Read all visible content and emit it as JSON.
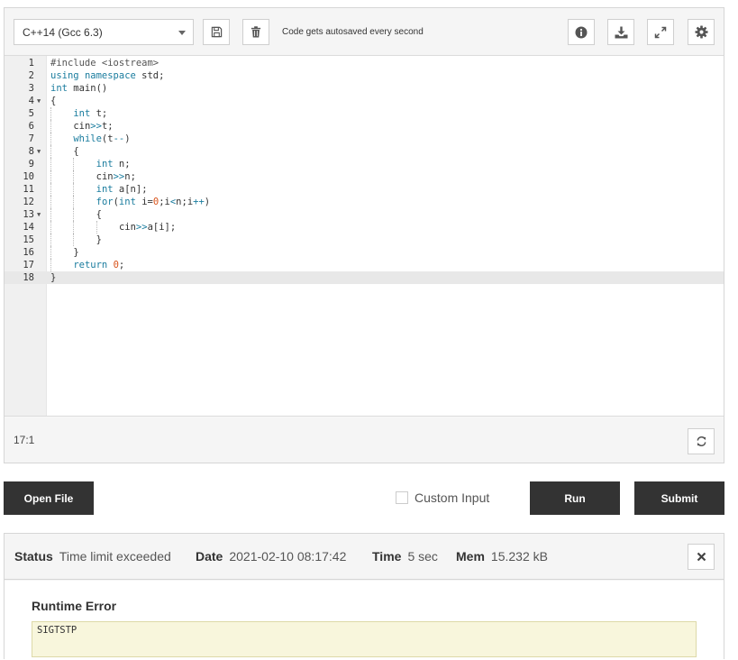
{
  "toolbar": {
    "language": "C++14 (Gcc 6.3)",
    "autosave_text": "Code gets autosaved every second",
    "icons": [
      "save-icon",
      "trash-icon",
      "info-icon",
      "download-icon",
      "expand-icon",
      "gear-icon"
    ]
  },
  "editor": {
    "active_line": 18,
    "lines": [
      {
        "n": "1",
        "fold": false,
        "indent": 0,
        "tokens": [
          [
            "pp",
            "#include <iostream>"
          ]
        ]
      },
      {
        "n": "2",
        "fold": false,
        "indent": 0,
        "tokens": [
          [
            "kw",
            "using"
          ],
          [
            "",
            " "
          ],
          [
            "kw",
            "namespace"
          ],
          [
            "",
            " std;"
          ]
        ]
      },
      {
        "n": "3",
        "fold": false,
        "indent": 0,
        "tokens": [
          [
            "kw",
            "int"
          ],
          [
            "",
            " main()"
          ]
        ]
      },
      {
        "n": "4",
        "fold": true,
        "indent": 0,
        "tokens": [
          [
            "",
            "{"
          ]
        ]
      },
      {
        "n": "5",
        "fold": false,
        "indent": 1,
        "tokens": [
          [
            "kw",
            "int"
          ],
          [
            "",
            " t;"
          ]
        ]
      },
      {
        "n": "6",
        "fold": false,
        "indent": 1,
        "tokens": [
          [
            "",
            "cin"
          ],
          [
            "kw",
            ">>"
          ],
          [
            "",
            "t;"
          ]
        ]
      },
      {
        "n": "7",
        "fold": false,
        "indent": 1,
        "tokens": [
          [
            "kw",
            "while"
          ],
          [
            "",
            "(t"
          ],
          [
            "kw",
            "--"
          ],
          [
            "",
            ")"
          ]
        ]
      },
      {
        "n": "8",
        "fold": true,
        "indent": 1,
        "tokens": [
          [
            "",
            "{"
          ]
        ]
      },
      {
        "n": "9",
        "fold": false,
        "indent": 2,
        "tokens": [
          [
            "kw",
            "int"
          ],
          [
            "",
            " n;"
          ]
        ]
      },
      {
        "n": "10",
        "fold": false,
        "indent": 2,
        "tokens": [
          [
            "",
            "cin"
          ],
          [
            "kw",
            ">>"
          ],
          [
            "",
            "n;"
          ]
        ]
      },
      {
        "n": "11",
        "fold": false,
        "indent": 2,
        "tokens": [
          [
            "kw",
            "int"
          ],
          [
            "",
            " a[n];"
          ]
        ]
      },
      {
        "n": "12",
        "fold": false,
        "indent": 2,
        "tokens": [
          [
            "kw",
            "for"
          ],
          [
            "",
            "("
          ],
          [
            "kw",
            "int"
          ],
          [
            "",
            " i="
          ],
          [
            "num",
            "0"
          ],
          [
            "",
            ";i"
          ],
          [
            "kw",
            "<"
          ],
          [
            "",
            "n;i"
          ],
          [
            "kw",
            "++"
          ],
          [
            "",
            ")"
          ]
        ]
      },
      {
        "n": "13",
        "fold": true,
        "indent": 2,
        "tokens": [
          [
            "",
            "{"
          ]
        ]
      },
      {
        "n": "14",
        "fold": false,
        "indent": 3,
        "tokens": [
          [
            "",
            "cin"
          ],
          [
            "kw",
            ">>"
          ],
          [
            "",
            "a[i];"
          ]
        ]
      },
      {
        "n": "15",
        "fold": false,
        "indent": 2,
        "tokens": [
          [
            "",
            "}"
          ]
        ]
      },
      {
        "n": "16",
        "fold": false,
        "indent": 1,
        "tokens": [
          [
            "",
            "}"
          ]
        ]
      },
      {
        "n": "17",
        "fold": false,
        "indent": 1,
        "tokens": [
          [
            "kw",
            "return"
          ],
          [
            "",
            " "
          ],
          [
            "num",
            "0"
          ],
          [
            "",
            ";"
          ]
        ]
      },
      {
        "n": "18",
        "fold": false,
        "indent": 0,
        "tokens": [
          [
            "",
            "}"
          ]
        ]
      }
    ],
    "cursor_position": "17:1"
  },
  "actions": {
    "open_file": "Open File",
    "custom_input": "Custom Input",
    "custom_input_checked": false,
    "run": "Run",
    "submit": "Submit"
  },
  "result": {
    "status_label": "Status",
    "status_value": "Time limit exceeded",
    "date_label": "Date",
    "date_value": "2021-02-10 08:17:42",
    "time_label": "Time",
    "time_value": "5 sec",
    "mem_label": "Mem",
    "mem_value": "15.232 kB",
    "runtime_title": "Runtime Error",
    "runtime_output": "SIGTSTP"
  },
  "colors": {
    "button_dark": "#333333",
    "keyword": "#1a7c9e",
    "number": "#d8531b",
    "error_bg": "#f8f6dc"
  }
}
